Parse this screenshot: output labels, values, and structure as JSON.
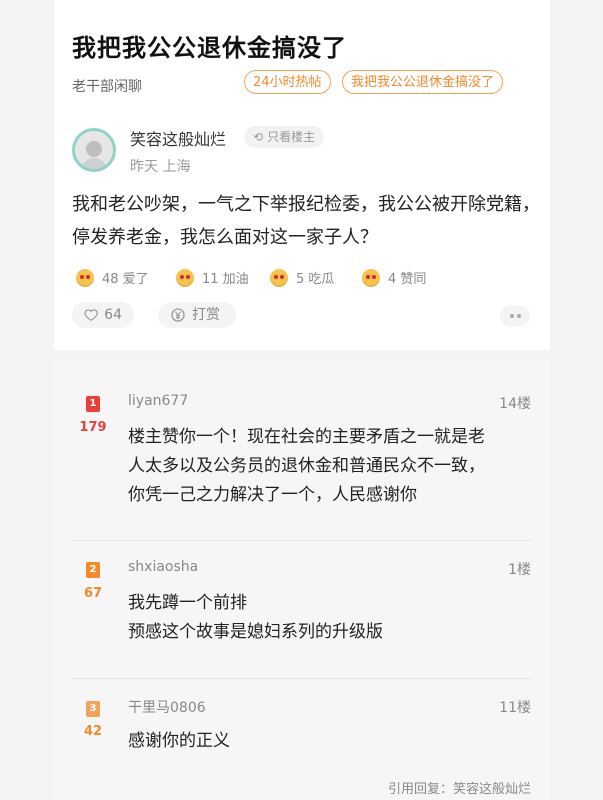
{
  "post": {
    "title": "我把我公公退休金搞没了",
    "board": "老干部闲聊",
    "tags": [
      "24小时热帖",
      "我把我公公退休金搞没了"
    ],
    "author": "笑容这般灿烂",
    "only_op_label": "只看楼主",
    "meta": "昨天 上海",
    "content": "我和老公吵架，一气之下举报纪检委，我公公被开除党籍，停发养老金，我怎么面对这一家子人？",
    "reactions": [
      {
        "icon": "heart-eyes-emoji-icon",
        "label": "48 爱了"
      },
      {
        "icon": "cheer-emoji-icon",
        "label": "11 加油"
      },
      {
        "icon": "melon-emoji-icon",
        "label": "5 吃瓜"
      },
      {
        "icon": "party-emoji-icon",
        "label": "4 赞同"
      }
    ],
    "like_count": "64",
    "tip_label": "打赏"
  },
  "replies": [
    {
      "rank": "1",
      "likes": "179",
      "user": "liyan677",
      "floor": "14楼",
      "text": [
        "楼主赞你一个！现在社会的主要矛盾之一就是老",
        "人太多以及公务员的退休金和普通民众不一致，",
        "你凭一己之力解决了一个，人民感谢你"
      ]
    },
    {
      "rank": "2",
      "likes": "67",
      "user": "shxiaosha",
      "floor": "1楼",
      "text": [
        "我先蹲一个前排",
        "预感这个故事是媳妇系列的升级版"
      ]
    },
    {
      "rank": "3",
      "likes": "42",
      "user": "干里马0806",
      "floor": "11楼",
      "text": [
        "感谢你的正义"
      ]
    }
  ],
  "quote_reply": "引用回复：笑容这般灿烂",
  "colors": {
    "rank1": "#e8413c",
    "rank2": "#f08a2b",
    "rank3": "#f0a35a",
    "accent": "#f08a2b"
  }
}
